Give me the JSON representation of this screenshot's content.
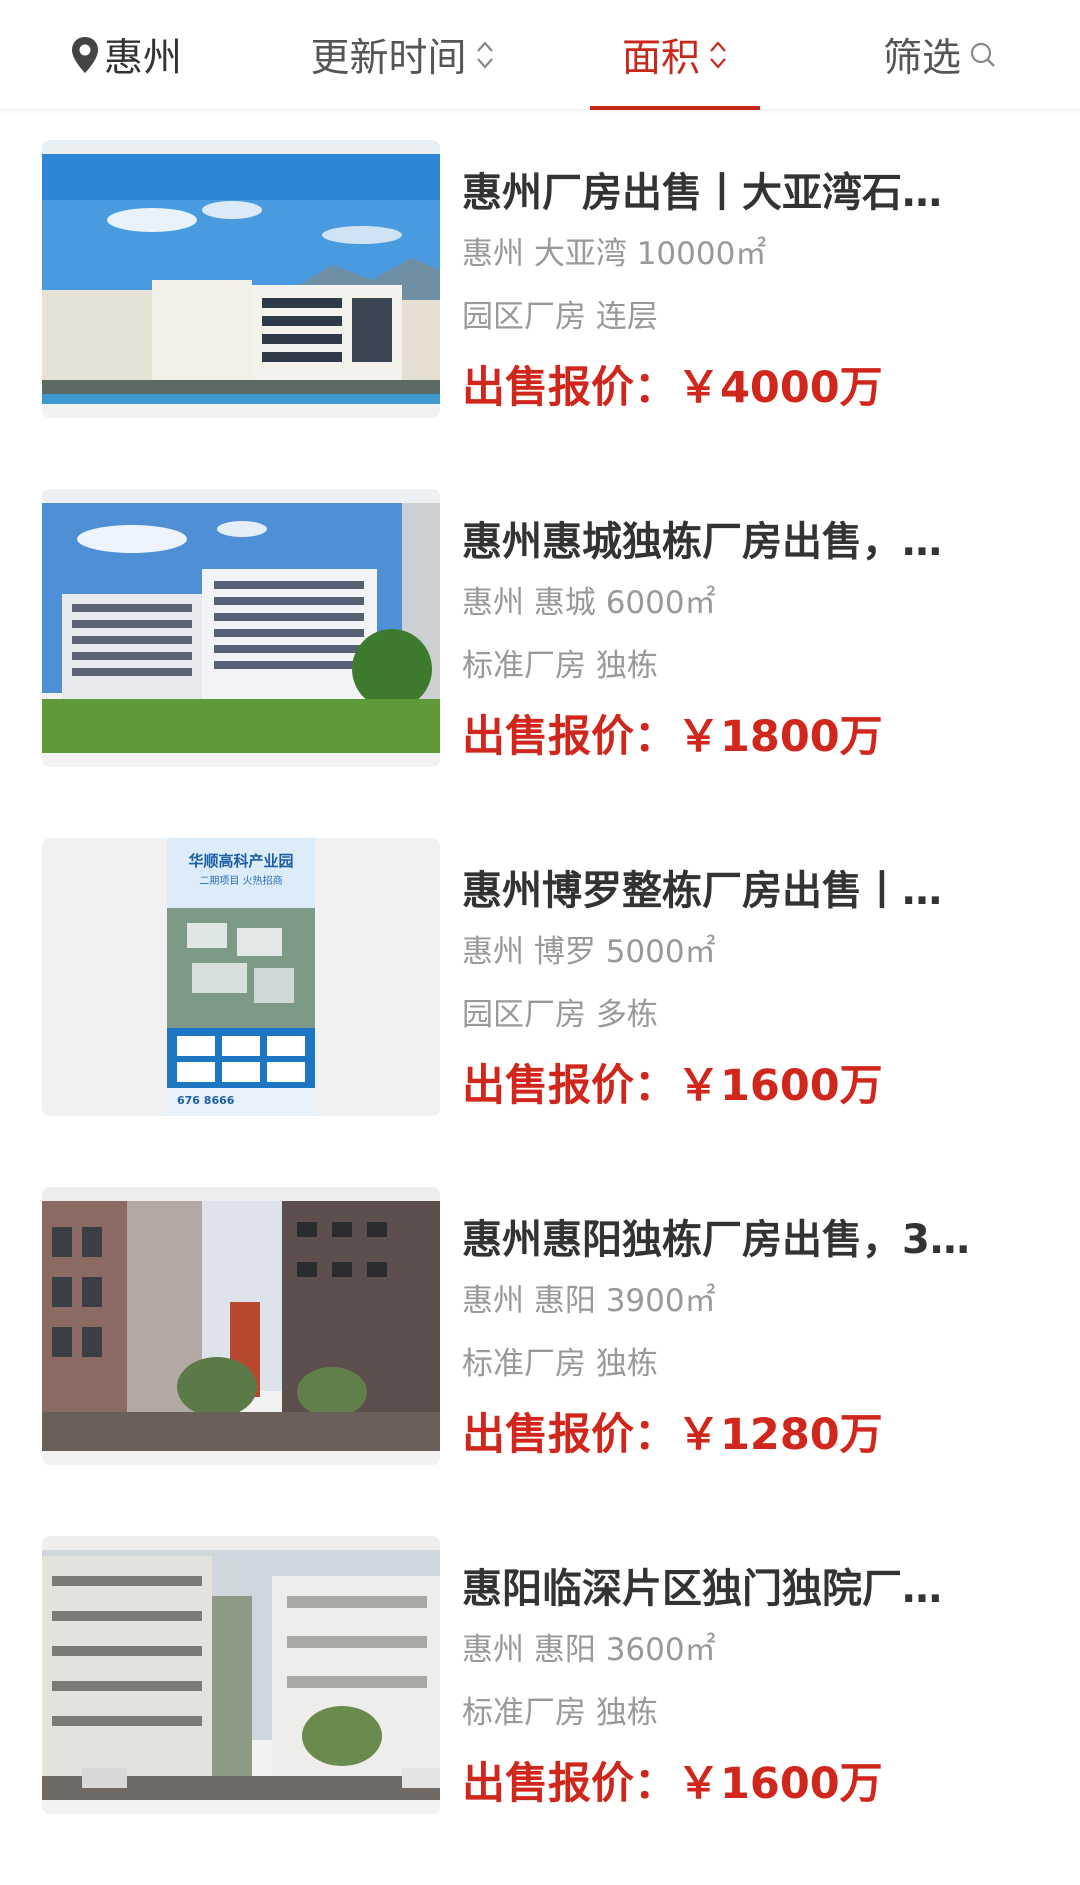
{
  "filter_bar": {
    "city": "惠州",
    "update_time": "更新时间",
    "area": "面积",
    "filter": "筛选"
  },
  "listings": [
    {
      "title": "惠州厂房出售丨大亚湾石…",
      "location": "惠州 大亚湾 10000㎡",
      "tags": "园区厂房 连层",
      "price_label": "出售报价：",
      "price": "￥4000万"
    },
    {
      "title": "惠州惠城独栋厂房出售，…",
      "location": "惠州 惠城 6000㎡",
      "tags": "标准厂房 独栋",
      "price_label": "出售报价：",
      "price": "￥1800万"
    },
    {
      "title": "惠州博罗整栋厂房出售丨…",
      "location": "惠州 博罗 5000㎡",
      "tags": "园区厂房 多栋",
      "price_label": "出售报价：",
      "price": "￥1600万",
      "poster": {
        "heading": "华顺高科产业园",
        "sub": "二期项目 火热招商",
        "phone": "676 8666"
      }
    },
    {
      "title": "惠州惠阳独栋厂房出售，3…",
      "location": "惠州 惠阳 3900㎡",
      "tags": "标准厂房 独栋",
      "price_label": "出售报价：",
      "price": "￥1280万"
    },
    {
      "title": "惠阳临深片区独门独院厂…",
      "location": "惠州 惠阳 3600㎡",
      "tags": "标准厂房 独栋",
      "price_label": "出售报价：",
      "price": "￥1600万"
    }
  ],
  "colors": {
    "accent": "#c8281c",
    "price": "#d0261b",
    "title": "#333333",
    "meta": "#999999"
  }
}
